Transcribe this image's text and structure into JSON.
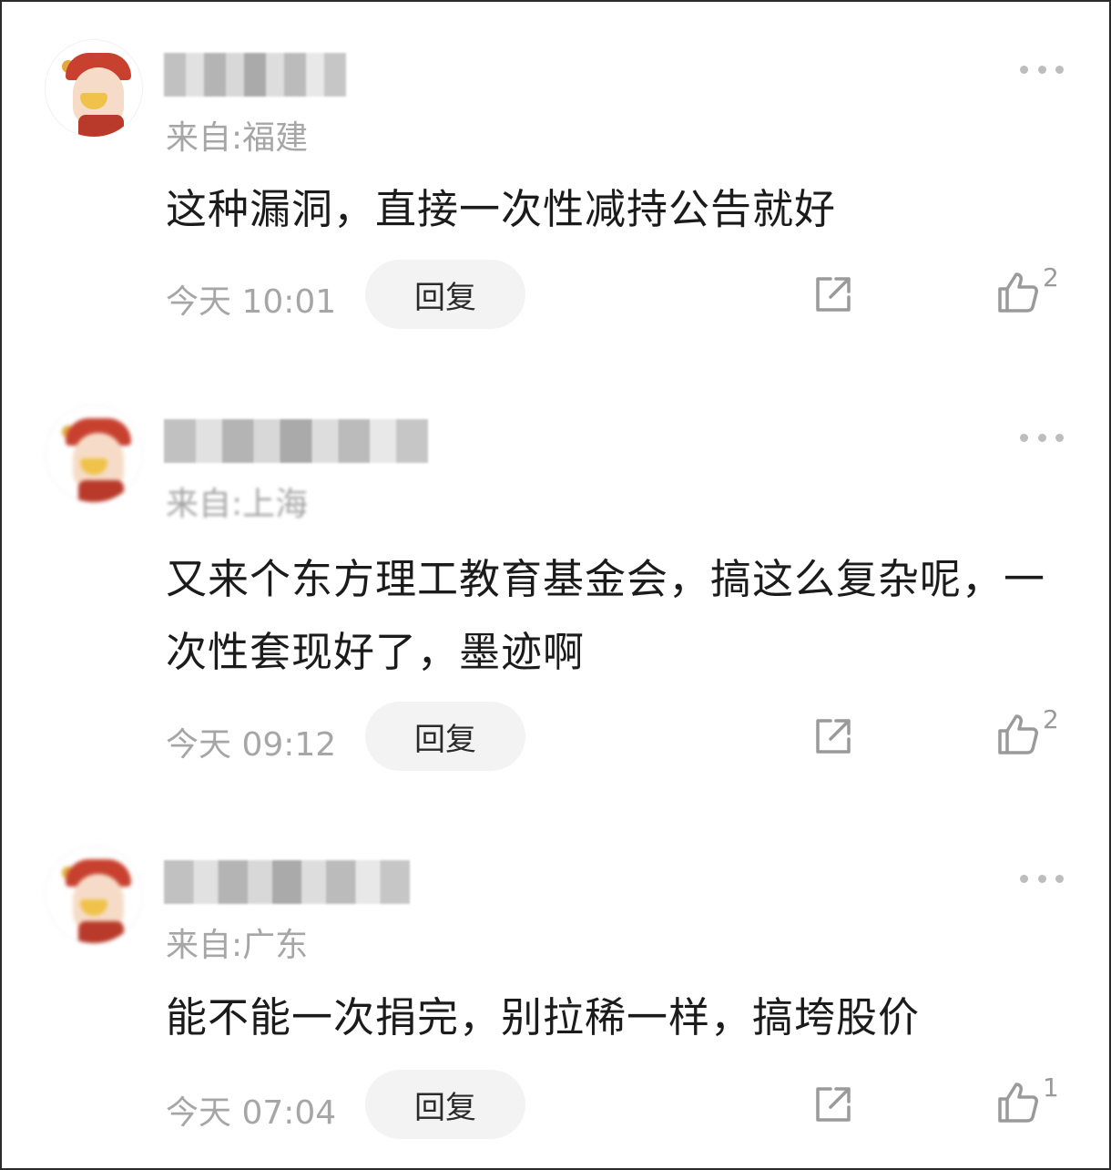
{
  "comments": [
    {
      "location": "来自:福建",
      "text": "这种漏洞，直接一次性减持公告就好",
      "time": "今天 10:01",
      "reply_label": "回复",
      "likes": "2"
    },
    {
      "location": "来自:上海",
      "text": "又来个东方理工教育基金会，搞这么复杂呢，一次性套现好了，墨迹啊",
      "time": "今天 09:12",
      "reply_label": "回复",
      "likes": "2"
    },
    {
      "location": "来自:广东",
      "text": "能不能一次捐完，别拉稀一样，搞垮股价",
      "time": "今天 07:04",
      "reply_label": "回复",
      "likes": "1"
    }
  ],
  "icons": {
    "more": "more-icon",
    "share": "share-icon",
    "like": "thumbs-up-icon"
  },
  "colors": {
    "text": "#1b1b1b",
    "meta": "#a6a6a6",
    "reply_bg": "#f3f3f3",
    "border": "#2a2a2a"
  }
}
